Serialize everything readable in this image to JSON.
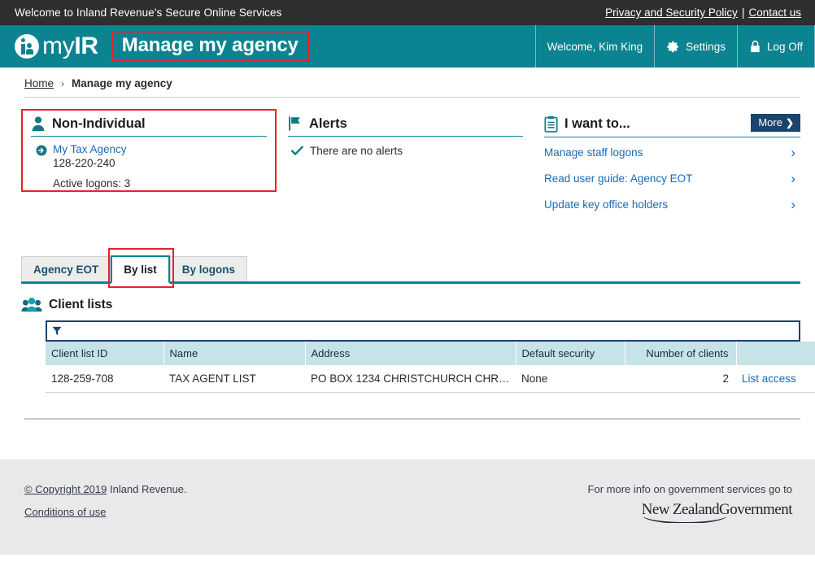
{
  "utility_bar": {
    "welcome_text": "Welcome to Inland Revenue's Secure Online Services",
    "privacy_link": "Privacy and Security Policy",
    "separator": "|",
    "contact_link": "Contact us"
  },
  "header": {
    "logo_text_light": "my",
    "logo_text_bold": "IR",
    "page_title": "Manage my agency",
    "welcome_user": "Welcome, Kim King",
    "settings_label": "Settings",
    "logoff_label": "Log Off",
    "teal": "#0c8391",
    "highlight_red": "#e8212a"
  },
  "breadcrumb": {
    "home": "Home",
    "separator": "›",
    "current": "Manage my agency"
  },
  "panels": {
    "non_individual": {
      "title": "Non-Individual",
      "agency_name": "My Tax Agency",
      "ird_number": "128-220-240",
      "active_logons": "Active logons: 3"
    },
    "alerts": {
      "title": "Alerts",
      "message": "There are no alerts"
    },
    "i_want_to": {
      "title": "I want to...",
      "more_label": "More",
      "more_chevron": "❯",
      "items": [
        {
          "label": "Manage staff logons"
        },
        {
          "label": "Read user guide: Agency EOT"
        },
        {
          "label": "Update key office holders"
        }
      ]
    }
  },
  "tabs": [
    {
      "label": "Agency EOT",
      "active": false
    },
    {
      "label": "By list",
      "active": true
    },
    {
      "label": "By logons",
      "active": false
    }
  ],
  "client_lists": {
    "section_title": "Client lists",
    "filter_value": "",
    "filter_placeholder": "",
    "columns": [
      "Client list ID",
      "Name",
      "Address",
      "Default security",
      "Number of clients",
      ""
    ],
    "rows": [
      {
        "client_list_id": "128-259-708",
        "name": "TAX AGENT LIST",
        "address": "PO BOX 1234 CHRISTCHURCH CHR…",
        "default_security": "None",
        "number_of_clients": "2",
        "action": "List access"
      }
    ]
  },
  "footer": {
    "copyright_link": "© Copyright 2019",
    "copyright_rest": " Inland Revenue.",
    "conditions_link": "Conditions of use",
    "gov_info": "For more info on government services go to",
    "gov_logo_nz": "New Zealand",
    "gov_logo_government": "Government"
  }
}
